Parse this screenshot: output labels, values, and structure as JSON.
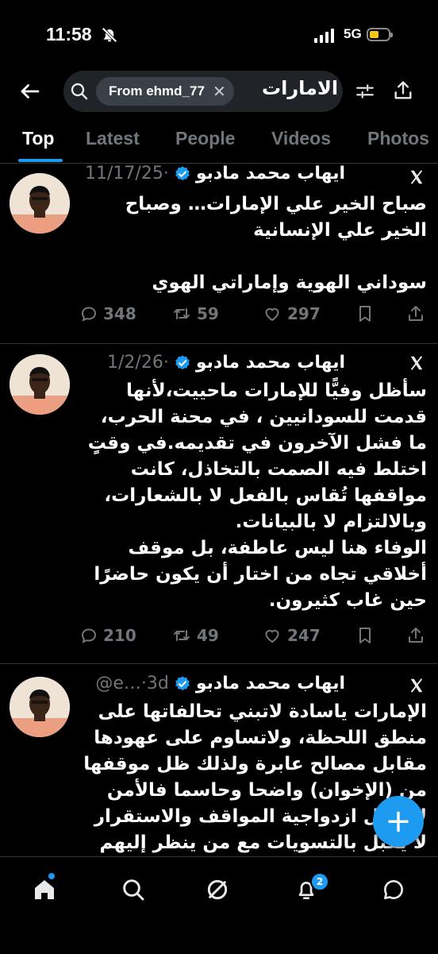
{
  "status": {
    "time": "11:58",
    "network": "5G"
  },
  "search": {
    "chip_label": "From ehmd_77",
    "query": "الامارات"
  },
  "tabs": [
    "Top",
    "Latest",
    "People",
    "Videos",
    "Photos"
  ],
  "tweets": [
    {
      "name": "ايهاب محمد مادبو",
      "date": "11/17/25",
      "text": "صباح الخير علي الإمارات… وصباح\nالخير علي الإنسانية\n\nسوداني الهوية وإماراتي الهوي",
      "replies": "348",
      "retweets": "59",
      "likes": "297"
    },
    {
      "name": "ايهاب محمد مادبو",
      "date": "1/2/26",
      "text": "سأظل وفيًّا للإمارات ماحييت،لأنها\nقدمت للسودانيين ، في محنة الحرب،\nما فشل الآخرون في تقديمه.في وقتٍ\nاختلط فيه الصمت بالتخاذل، كانت\nمواقفها تُقاس بالفعل لا بالشعارات،\nوبالالتزام لا بالبيانات.\nالوفاء هنا ليس عاطفة، بل موقف\nأخلاقي تجاه من اختار أن يكون حاضرًا\nحين غاب كثيرون.",
      "replies": "210",
      "retweets": "49",
      "likes": "247"
    },
    {
      "name": "ايهاب محمد مادبو",
      "handle": "@e…",
      "date": "3d",
      "text": "الإمارات ياسادة لاتبني تحالفاتها على\nمنطق اللحظة، ولاتساوم على عهودها\nمقابل مصالح عابرة ولذلك ظل موقفها\nمن (الإخوان) واضحا وحاسما فالأمن\nلا يقبل ازدواجية المواقف والاستقرار\nلا يقبل بالتسويات مع من ينظر إليهم"
    }
  ],
  "nav": {
    "notifications_badge": "2"
  },
  "colors": {
    "accent": "#1d9bf0",
    "muted": "#71767b",
    "background": "#000000"
  }
}
